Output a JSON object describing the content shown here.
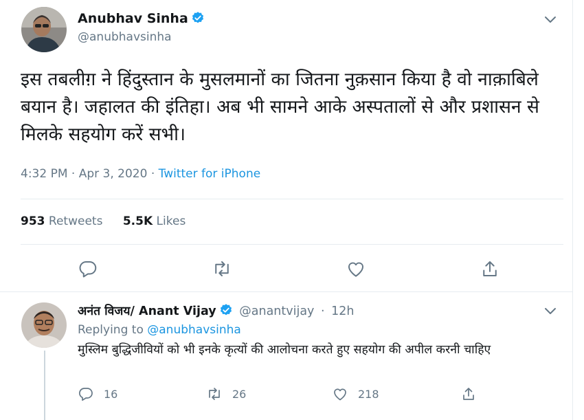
{
  "tweet": {
    "author": {
      "name": "Anubhav Sinha",
      "handle": "@anubhavsinha"
    },
    "text": "इस तबलीग़ ने हिंदुस्तान के मुसलमानों का जितना नुक़सान किया है वो नाक़ाबिले बयान है। जहालत की इंतिहा। अब भी सामने आके अस्पतालों से और प्रशासन से मिलके सहयोग करें सभी।",
    "time": "4:32 PM",
    "date": "Apr 3, 2020",
    "separator": "·",
    "source": "Twitter for iPhone",
    "stats": {
      "retweets_count": "953",
      "retweets_label": "Retweets",
      "likes_count": "5.5K",
      "likes_label": "Likes"
    },
    "actions": [
      "reply-icon",
      "retweet-icon",
      "like-icon",
      "share-icon"
    ]
  },
  "reply": {
    "author": {
      "name": "अनंत विजय/ Anant Vijay",
      "handle": "@anantvijay",
      "separator": "·",
      "time": "12h"
    },
    "replying_prefix": "Replying to",
    "replying_to": "@anubhavsinha",
    "text": "मुस्लिम बुद्धिजीवियों को भी इनके कृत्यों की आलोचना करते हुए सहयोग की अपील करनी चाहिए",
    "counts": {
      "replies": "16",
      "retweets": "26",
      "likes": "218"
    }
  },
  "colors": {
    "text": "#14171a",
    "secondary": "#657786",
    "link": "#1b95e0",
    "verified": "#1da1f2",
    "border": "#e6ecf0"
  }
}
